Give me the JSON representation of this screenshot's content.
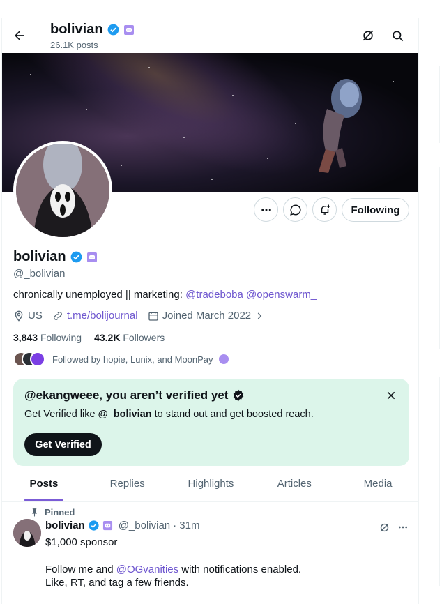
{
  "header": {
    "name": "bolivian",
    "posts": "26.1K posts"
  },
  "profile": {
    "name": "bolivian",
    "handle": "@_bolivian",
    "bio_text": "chronically unemployed || marketing: ",
    "bio_mention1": "@tradeboba",
    "bio_mention2": "@openswarm_",
    "location": "US",
    "website": "t.me/bolijournal",
    "joined": "Joined March 2022",
    "following_count": "3,843",
    "following_label": "Following",
    "followers_count": "43.2K",
    "followers_label": "Followers",
    "followed_by": "Followed by hopie, Lunix, and MoonPay",
    "follow_button": "Following"
  },
  "verify_card": {
    "title": "@ekangweee, you aren’t verified yet",
    "text_before": "Get Verified like ",
    "text_handle": "@_bolivian",
    "text_after": " to stand out and get boosted reach.",
    "button": "Get Verified"
  },
  "tabs": [
    {
      "label": "Posts",
      "active": true
    },
    {
      "label": "Replies",
      "active": false
    },
    {
      "label": "Highlights",
      "active": false
    },
    {
      "label": "Articles",
      "active": false
    },
    {
      "label": "Media",
      "active": false
    }
  ],
  "pinned_post": {
    "pinned_label": "Pinned",
    "author": "bolivian",
    "handle": "@_bolivian",
    "time": "· 31m",
    "line1": "$1,000 sponsor",
    "line2_before": "Follow me and ",
    "line2_mention": "@OGvanities",
    "line2_after": " with notifications enabled.",
    "line3": "Like, RT, and tag a few friends."
  },
  "colors": {
    "verified_blue": "#1d9bf0",
    "accent_purple": "#7b5cd6",
    "link_purple": "#6e56cf",
    "card_green": "#dcf5ea"
  }
}
